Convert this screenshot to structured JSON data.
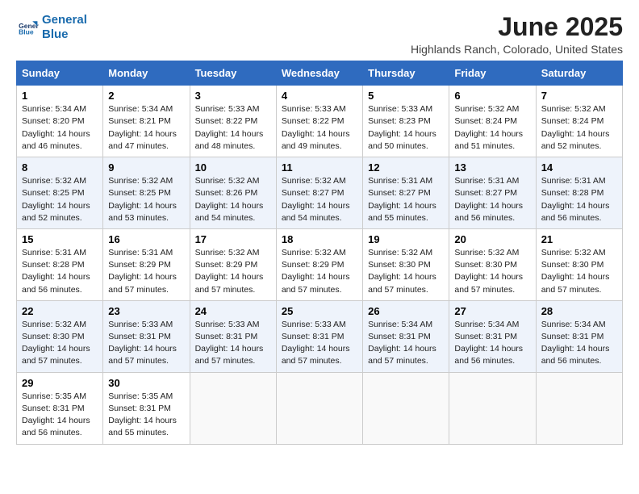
{
  "logo": {
    "line1": "General",
    "line2": "Blue",
    "icon_color": "#1a6bad"
  },
  "title": "June 2025",
  "location": "Highlands Ranch, Colorado, United States",
  "days_of_week": [
    "Sunday",
    "Monday",
    "Tuesday",
    "Wednesday",
    "Thursday",
    "Friday",
    "Saturday"
  ],
  "weeks": [
    [
      {
        "day": "1",
        "sunrise": "5:34 AM",
        "sunset": "8:20 PM",
        "daylight": "14 hours and 46 minutes."
      },
      {
        "day": "2",
        "sunrise": "5:34 AM",
        "sunset": "8:21 PM",
        "daylight": "14 hours and 47 minutes."
      },
      {
        "day": "3",
        "sunrise": "5:33 AM",
        "sunset": "8:22 PM",
        "daylight": "14 hours and 48 minutes."
      },
      {
        "day": "4",
        "sunrise": "5:33 AM",
        "sunset": "8:22 PM",
        "daylight": "14 hours and 49 minutes."
      },
      {
        "day": "5",
        "sunrise": "5:33 AM",
        "sunset": "8:23 PM",
        "daylight": "14 hours and 50 minutes."
      },
      {
        "day": "6",
        "sunrise": "5:32 AM",
        "sunset": "8:24 PM",
        "daylight": "14 hours and 51 minutes."
      },
      {
        "day": "7",
        "sunrise": "5:32 AM",
        "sunset": "8:24 PM",
        "daylight": "14 hours and 52 minutes."
      }
    ],
    [
      {
        "day": "8",
        "sunrise": "5:32 AM",
        "sunset": "8:25 PM",
        "daylight": "14 hours and 52 minutes."
      },
      {
        "day": "9",
        "sunrise": "5:32 AM",
        "sunset": "8:25 PM",
        "daylight": "14 hours and 53 minutes."
      },
      {
        "day": "10",
        "sunrise": "5:32 AM",
        "sunset": "8:26 PM",
        "daylight": "14 hours and 54 minutes."
      },
      {
        "day": "11",
        "sunrise": "5:32 AM",
        "sunset": "8:27 PM",
        "daylight": "14 hours and 54 minutes."
      },
      {
        "day": "12",
        "sunrise": "5:31 AM",
        "sunset": "8:27 PM",
        "daylight": "14 hours and 55 minutes."
      },
      {
        "day": "13",
        "sunrise": "5:31 AM",
        "sunset": "8:27 PM",
        "daylight": "14 hours and 56 minutes."
      },
      {
        "day": "14",
        "sunrise": "5:31 AM",
        "sunset": "8:28 PM",
        "daylight": "14 hours and 56 minutes."
      }
    ],
    [
      {
        "day": "15",
        "sunrise": "5:31 AM",
        "sunset": "8:28 PM",
        "daylight": "14 hours and 56 minutes."
      },
      {
        "day": "16",
        "sunrise": "5:31 AM",
        "sunset": "8:29 PM",
        "daylight": "14 hours and 57 minutes."
      },
      {
        "day": "17",
        "sunrise": "5:32 AM",
        "sunset": "8:29 PM",
        "daylight": "14 hours and 57 minutes."
      },
      {
        "day": "18",
        "sunrise": "5:32 AM",
        "sunset": "8:29 PM",
        "daylight": "14 hours and 57 minutes."
      },
      {
        "day": "19",
        "sunrise": "5:32 AM",
        "sunset": "8:30 PM",
        "daylight": "14 hours and 57 minutes."
      },
      {
        "day": "20",
        "sunrise": "5:32 AM",
        "sunset": "8:30 PM",
        "daylight": "14 hours and 57 minutes."
      },
      {
        "day": "21",
        "sunrise": "5:32 AM",
        "sunset": "8:30 PM",
        "daylight": "14 hours and 57 minutes."
      }
    ],
    [
      {
        "day": "22",
        "sunrise": "5:32 AM",
        "sunset": "8:30 PM",
        "daylight": "14 hours and 57 minutes."
      },
      {
        "day": "23",
        "sunrise": "5:33 AM",
        "sunset": "8:31 PM",
        "daylight": "14 hours and 57 minutes."
      },
      {
        "day": "24",
        "sunrise": "5:33 AM",
        "sunset": "8:31 PM",
        "daylight": "14 hours and 57 minutes."
      },
      {
        "day": "25",
        "sunrise": "5:33 AM",
        "sunset": "8:31 PM",
        "daylight": "14 hours and 57 minutes."
      },
      {
        "day": "26",
        "sunrise": "5:34 AM",
        "sunset": "8:31 PM",
        "daylight": "14 hours and 57 minutes."
      },
      {
        "day": "27",
        "sunrise": "5:34 AM",
        "sunset": "8:31 PM",
        "daylight": "14 hours and 56 minutes."
      },
      {
        "day": "28",
        "sunrise": "5:34 AM",
        "sunset": "8:31 PM",
        "daylight": "14 hours and 56 minutes."
      }
    ],
    [
      {
        "day": "29",
        "sunrise": "5:35 AM",
        "sunset": "8:31 PM",
        "daylight": "14 hours and 56 minutes."
      },
      {
        "day": "30",
        "sunrise": "5:35 AM",
        "sunset": "8:31 PM",
        "daylight": "14 hours and 55 minutes."
      },
      null,
      null,
      null,
      null,
      null
    ]
  ]
}
